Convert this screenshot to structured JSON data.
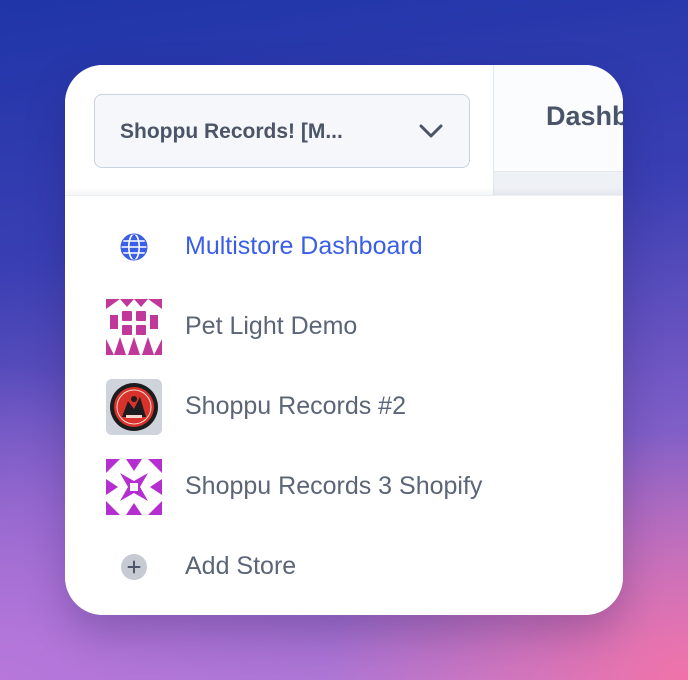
{
  "header": {
    "title": "Dashboard",
    "store_select": {
      "selected": "Shoppu Records! [M...",
      "icon": "chevron-down-icon"
    }
  },
  "menu": {
    "items": [
      {
        "label": "Multistore Dashboard",
        "icon": "globe-icon",
        "active": true
      },
      {
        "label": "Pet Light Demo",
        "icon": "store-avatar-pet-light-demo"
      },
      {
        "label": "Shoppu Records #2",
        "icon": "store-avatar-shoppu-records-2"
      },
      {
        "label": "Shoppu Records 3 Shopify",
        "icon": "store-avatar-shoppu-records-3"
      },
      {
        "label": "Add Store",
        "icon": "plus-circle-icon"
      }
    ]
  },
  "colors": {
    "accent": "#3a5ee6",
    "text": "#5b6577",
    "pet_light_identicon": "#c0389a",
    "shoppu_3_identicon": "#b52fd0",
    "record_label_red": "#d8322a"
  }
}
